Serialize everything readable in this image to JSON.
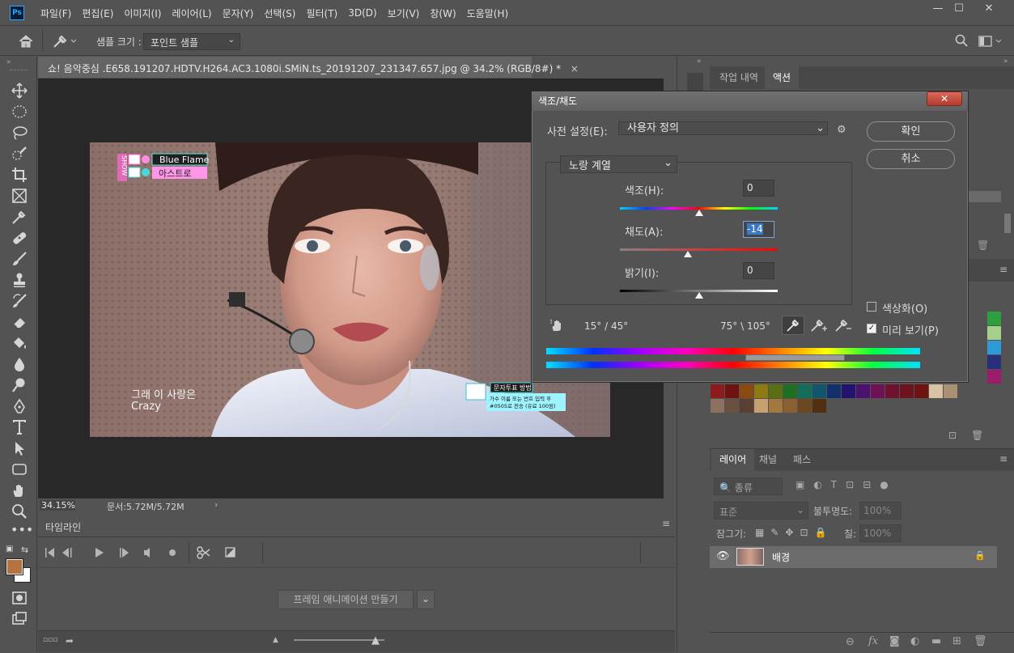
{
  "app": {
    "logo": "Ps",
    "menu": [
      "파일(F)",
      "편집(E)",
      "이미지(I)",
      "레이어(L)",
      "문자(Y)",
      "선택(S)",
      "필터(T)",
      "3D(D)",
      "보기(V)",
      "창(W)",
      "도움말(H)"
    ]
  },
  "window_controls": {
    "minimize": "—",
    "maximize": "☐",
    "close": "✕"
  },
  "options": {
    "sample_size_label": "샘플 크기 :",
    "sample_size_value": "포인트 샘플"
  },
  "document": {
    "tab_title": "쇼! 음악중심 .E658.191207.HDTV.H264.AC3.1080i.SMiN.ts_20191207_231347.657.jpg @ 34.2% (RGB/8#) *",
    "tab_close": "×",
    "zoom": "34.15%",
    "doc_size": "문서:5.72M/5.72M"
  },
  "photo": {
    "show_logo": "SHOW",
    "song": "Blue Flame",
    "artist": "아스트로",
    "lyric1": "그래 이 사랑은",
    "lyric2": "Crazy",
    "vote_title": "문자투표 방법",
    "vote_line1": "가수 이름 또는 번호 입력 후",
    "vote_line2": "#0505로 전송 (유료 100원)"
  },
  "timeline": {
    "tab": "타임라인",
    "make_frame": "프레임 애니메이션 만들기"
  },
  "right_panels": {
    "history_tab": "작업 내역",
    "actions_tab": "액션",
    "layers_tabs": [
      "레이어",
      "채널",
      "패스"
    ],
    "filter_kind": "종류",
    "blend_mode": "표준",
    "opacity_label": "불투명도:",
    "opacity_value": "100%",
    "lock_label": "잠그기:",
    "fill_label": "칠:",
    "fill_value": "100%",
    "layer_name": "배경"
  },
  "dialog": {
    "title": "색조/채도",
    "preset_label": "사전 설정(E):",
    "preset_value": "사용자 정의",
    "channel": "노랑 계열",
    "ok": "확인",
    "cancel": "취소",
    "hue_label": "색조(H):",
    "hue_value": "0",
    "hue_level": 0,
    "sat_label": "채도(A):",
    "sat_value": "-14",
    "sat_level": -14,
    "light_label": "밝기(I):",
    "light_value": "0",
    "light_level": 0,
    "colorize_label": "색상화(O)",
    "colorize_checked": false,
    "preview_label": "미리 보기(P)",
    "preview_checked": true,
    "range_left": "15° / 45°",
    "range_right": "75° \\ 105°"
  },
  "colors": {
    "accent": "#31a8ff",
    "fg_swatch": "#b5733f",
    "bg_swatch": "#ffffff",
    "ui_bg": "#535353"
  },
  "icons": [
    "home-icon",
    "eyedropper-icon",
    "search-icon",
    "workspace-icon",
    "move-icon",
    "marquee-icon",
    "lasso-icon",
    "quick-select-icon",
    "crop-icon",
    "frame-icon",
    "eyedropper-tool-icon",
    "healing-icon",
    "brush-icon",
    "stamp-icon",
    "history-brush-icon",
    "eraser-icon",
    "bucket-icon",
    "blur-icon",
    "dodge-icon",
    "pen-icon",
    "type-icon",
    "path-select-icon",
    "shape-icon",
    "hand-icon",
    "zoom-icon",
    "more-icon",
    "gear-icon",
    "target-adjust-icon",
    "eye-icon",
    "lock-icon",
    "trash-icon",
    "scissors-icon",
    "play-icon"
  ]
}
